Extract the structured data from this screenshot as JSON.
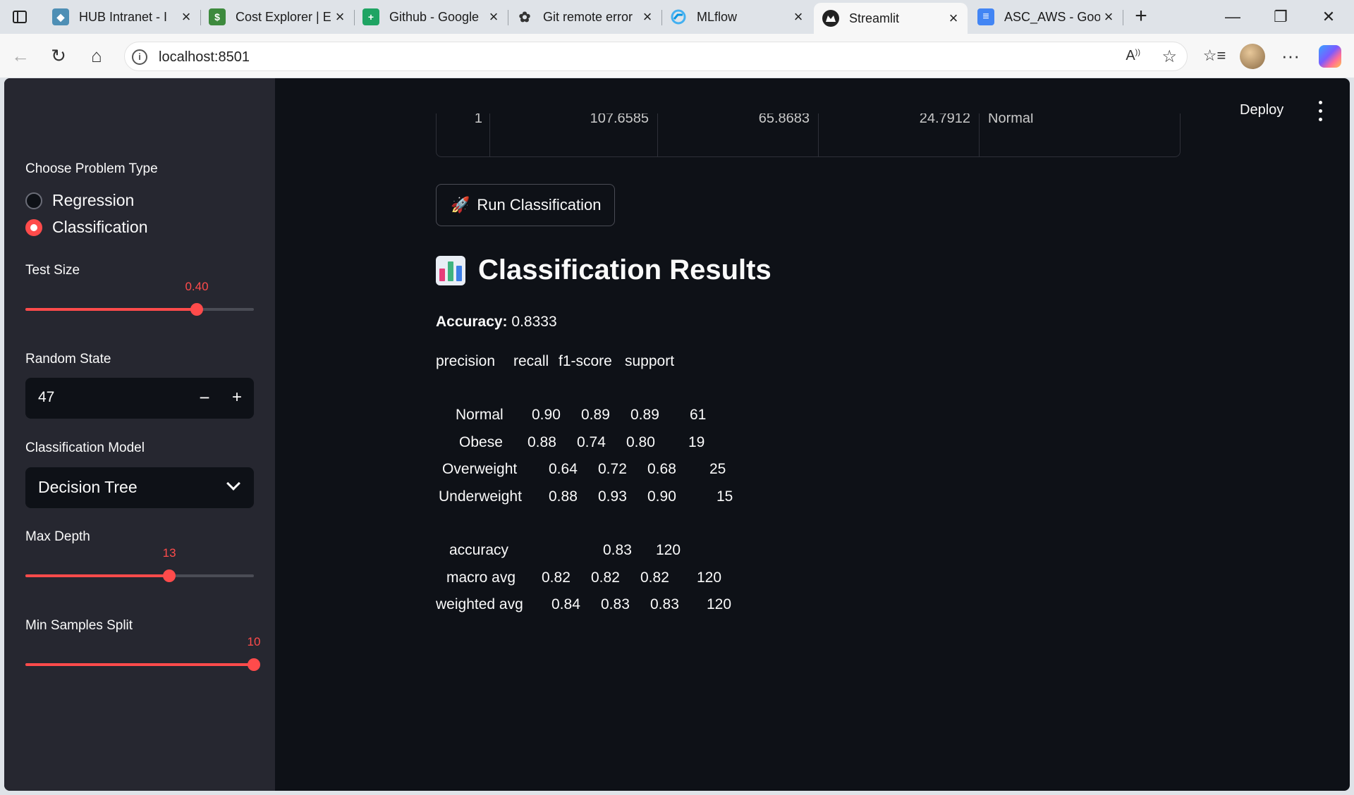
{
  "browser": {
    "tabs": [
      {
        "title": "HUB Intranet - I",
        "icon": "hub-icon",
        "color": "#4e8fb5"
      },
      {
        "title": "Cost Explorer | E",
        "icon": "cost-explorer-icon",
        "color": "#3d8a3d"
      },
      {
        "title": "Github - Google",
        "icon": "sheets-icon",
        "color": "#1fa463"
      },
      {
        "title": "Git remote error",
        "icon": "chatgpt-icon",
        "color": "#333333"
      },
      {
        "title": "MLflow",
        "icon": "mlflow-icon",
        "color": "#43b0f1"
      },
      {
        "title": "Streamlit",
        "icon": "streamlit-icon",
        "color": "#222222"
      },
      {
        "title": "ASC_AWS - Goo",
        "icon": "docs-icon",
        "color": "#4285f4"
      }
    ],
    "url": "localhost:8501"
  },
  "sidebar": {
    "problem_type_label": "Choose Problem Type",
    "problem_types": [
      "Regression",
      "Classification"
    ],
    "selected_problem_type": "Classification",
    "test_size_label": "Test Size",
    "test_size_value": "0.40",
    "test_size_fraction": 0.75,
    "random_state_label": "Random State",
    "random_state_value": "47",
    "stepper_minus": "−",
    "stepper_plus": "+",
    "model_label": "Classification Model",
    "model_value": "Decision Tree",
    "max_depth_label": "Max Depth",
    "max_depth_value": "13",
    "max_depth_fraction": 0.63,
    "min_samples_label": "Min Samples Split",
    "min_samples_value": "10",
    "min_samples_fraction": 1.0
  },
  "header": {
    "deploy_label": "Deploy"
  },
  "table_stub": {
    "cells": [
      "1",
      "107.6585",
      "65.8683",
      "24.7912",
      "Normal"
    ]
  },
  "main": {
    "run_button_label": "Run Classification",
    "results_title": "Classification Results",
    "accuracy_label": "Accuracy:",
    "accuracy_value": "0.8333",
    "report_header": [
      "precision",
      "recall",
      "f1-score",
      "support"
    ],
    "report_rows": [
      {
        "label": "Normal",
        "precision": "0.90",
        "recall": "0.89",
        "f1": "0.89",
        "support": "61"
      },
      {
        "label": "Obese",
        "precision": "0.88",
        "recall": "0.74",
        "f1": "0.80",
        "support": "19"
      },
      {
        "label": "Overweight",
        "precision": "0.64",
        "recall": "0.72",
        "f1": "0.68",
        "support": "25"
      },
      {
        "label": "Underweight",
        "precision": "0.88",
        "recall": "0.93",
        "f1": "0.90",
        "support": "15"
      }
    ],
    "report_summary": [
      {
        "label": "accuracy",
        "precision": "",
        "recall": "",
        "f1": "0.83",
        "support": "120"
      },
      {
        "label": "macro avg",
        "precision": "0.82",
        "recall": "0.82",
        "f1": "0.82",
        "support": "120"
      },
      {
        "label": "weighted avg",
        "precision": "0.84",
        "recall": "0.83",
        "f1": "0.83",
        "support": "120"
      }
    ]
  },
  "colors": {
    "accent": "#ff4b4b",
    "app_bg": "#0e1117",
    "sidebar_bg": "#262730"
  }
}
